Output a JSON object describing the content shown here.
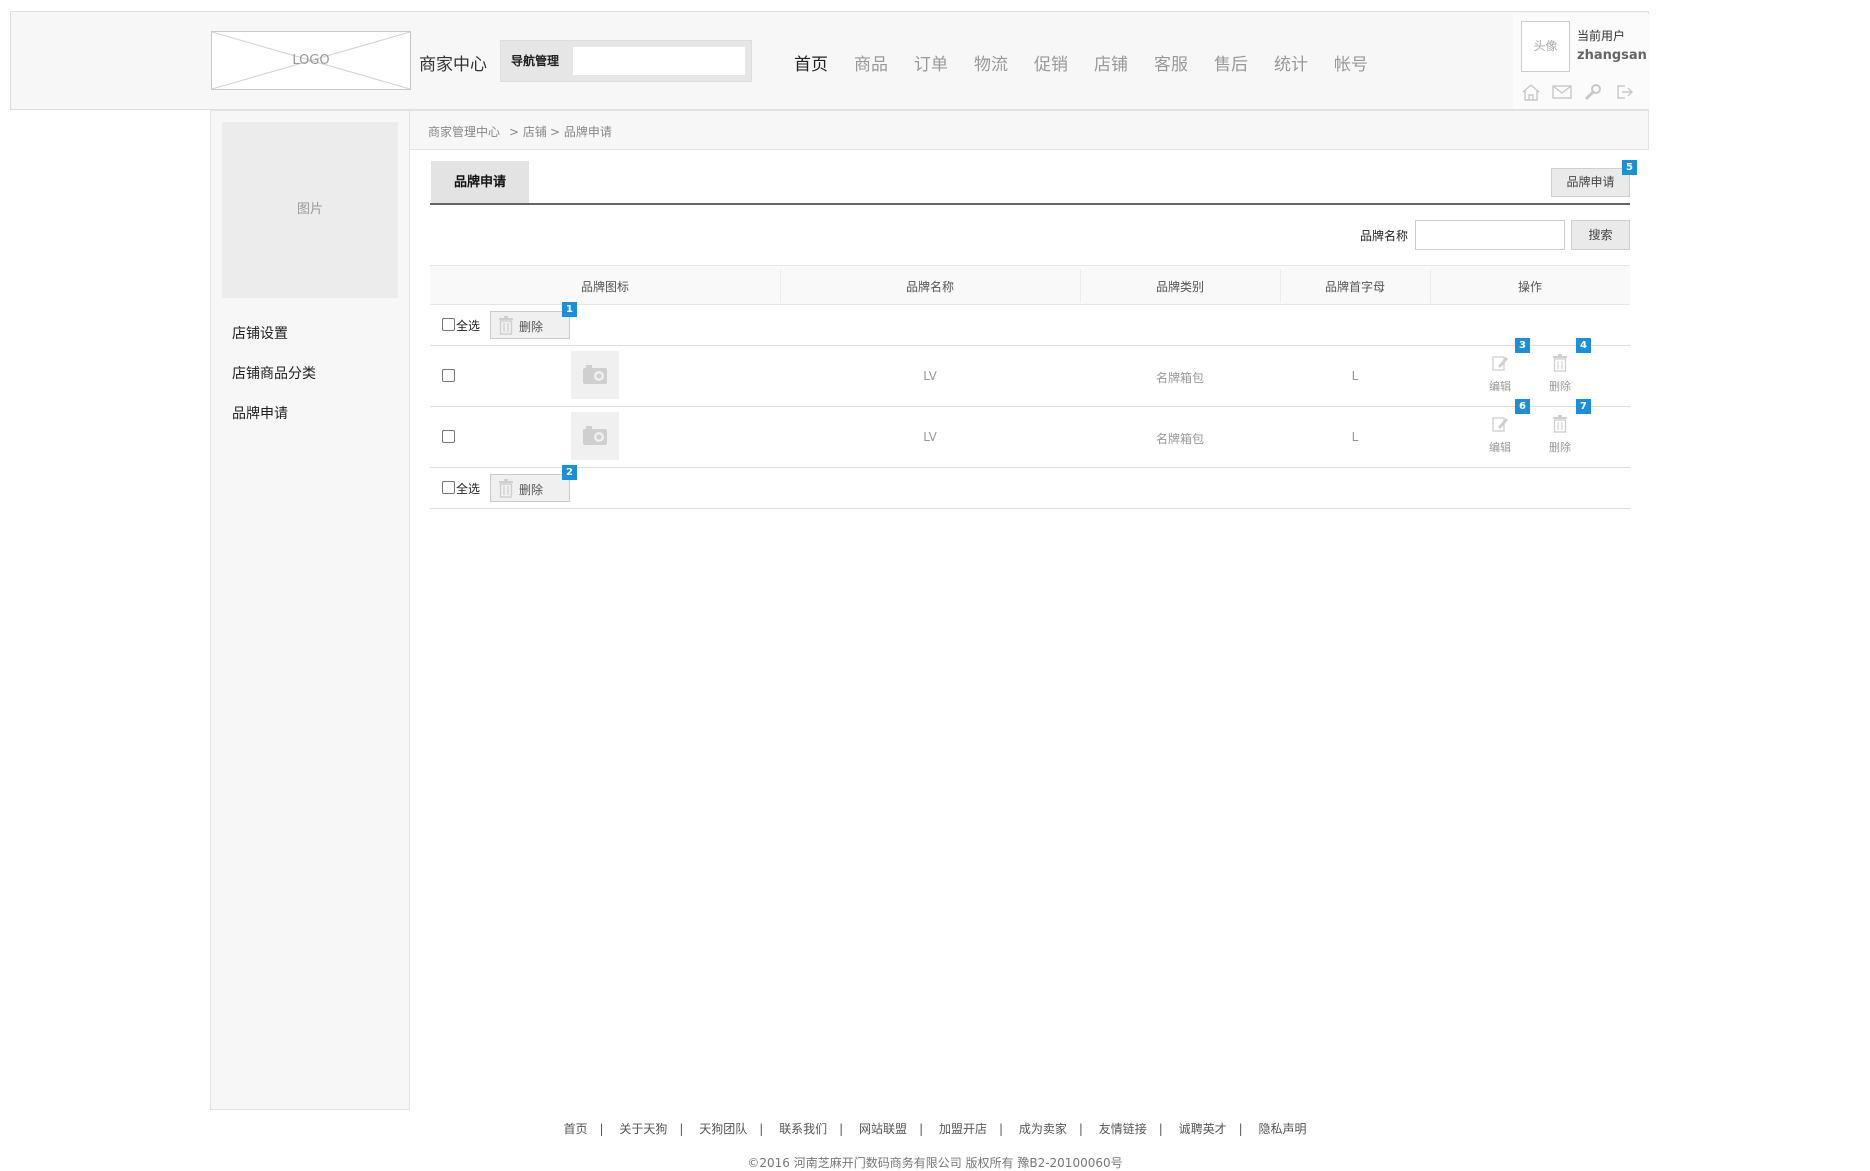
{
  "header": {
    "logo": "LOGO",
    "site_name": "商家中心",
    "nav_mgmt_label": "导航管理",
    "nav_mgmt_value": "",
    "nav": [
      "首页",
      "商品",
      "订单",
      "物流",
      "促销",
      "店铺",
      "客服",
      "售后",
      "统计",
      "帐号"
    ],
    "active_nav": "首页"
  },
  "user": {
    "avatar_text": "头像",
    "current_user_label": "当前用户",
    "username": "zhangsan",
    "icons": [
      "home-icon",
      "mail-icon",
      "wrench-icon",
      "logout-icon"
    ]
  },
  "sidebar": {
    "picture_text": "图片",
    "items": [
      "店铺设置",
      "店铺商品分类",
      "品牌申请"
    ]
  },
  "breadcrumb": [
    "商家管理中心",
    "> 店铺",
    "> 品牌申请"
  ],
  "tab": {
    "label": "品牌申请"
  },
  "apply_button": {
    "label": "品牌申请",
    "marker": "5"
  },
  "search": {
    "label": "品牌名称",
    "value": "",
    "button": "搜索"
  },
  "table": {
    "headers": [
      "品牌图标",
      "品牌名称",
      "品牌类别",
      "品牌首字母",
      "操作"
    ],
    "select_all": "全选",
    "delete_label": "删除",
    "top_marker": "1",
    "bottom_marker": "2",
    "rows": [
      {
        "name": "LV",
        "category": "名牌箱包",
        "initial": "L",
        "edit": "编辑",
        "delete": "删除",
        "edit_marker": "3",
        "delete_marker": "4"
      },
      {
        "name": "LV",
        "category": "名牌箱包",
        "initial": "L",
        "edit": "编辑",
        "delete": "删除",
        "edit_marker": "6",
        "delete_marker": "7"
      }
    ]
  },
  "footer": {
    "links": [
      "首页",
      "关于天狗",
      "天狗团队",
      "联系我们",
      "网站联盟",
      "加盟开店",
      "成为卖家",
      "友情链接",
      "诚聘英才",
      "隐私声明"
    ],
    "copyright": "©2016 河南芝麻开门数码商务有限公司 版权所有 豫B2-20100060号"
  },
  "colors": {
    "marker": "#1b8fd8",
    "tab_line": "#666666",
    "panel_bg": "#f7f7f7"
  }
}
